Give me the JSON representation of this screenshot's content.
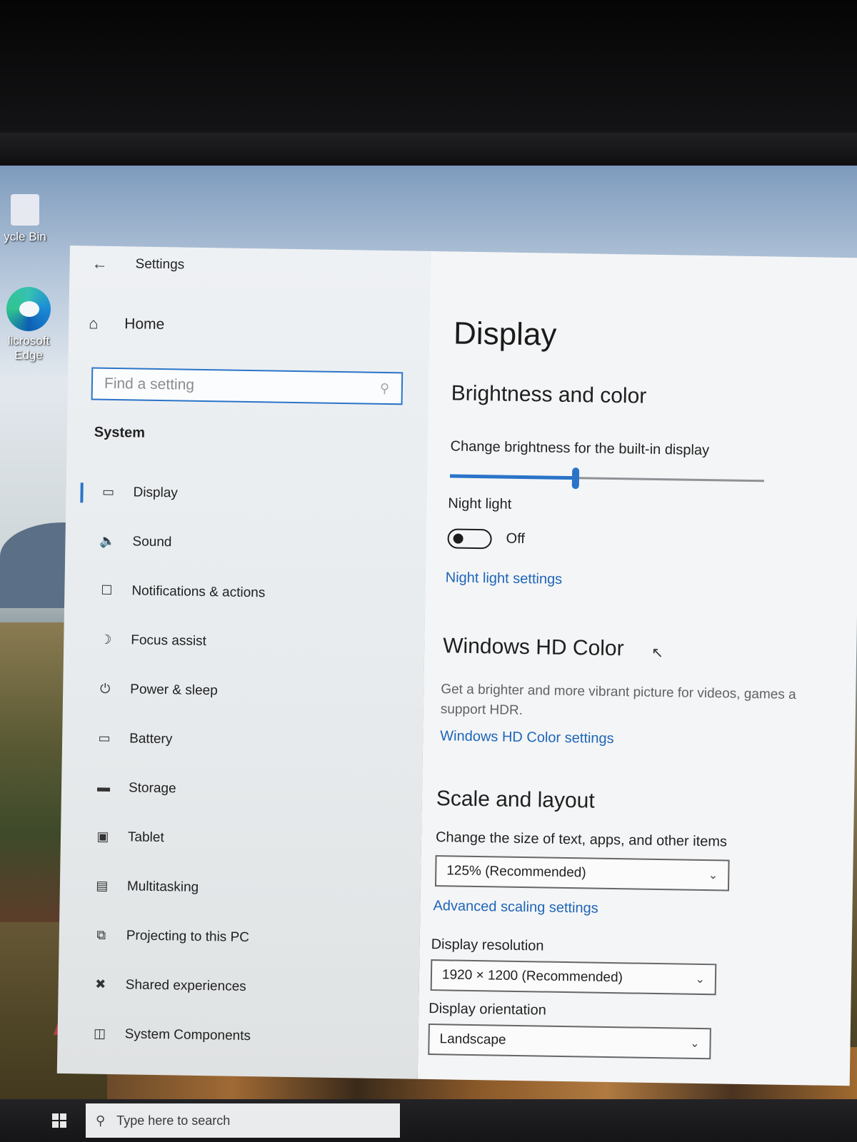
{
  "desktop": {
    "icons": [
      {
        "label": "ycle Bin"
      },
      {
        "label": "licrosoft Edge"
      }
    ]
  },
  "settings": {
    "title": "Settings",
    "home_label": "Home",
    "search_placeholder": "Find a setting",
    "section_header": "System",
    "nav_items": [
      {
        "label": "Display",
        "icon": "monitor-icon",
        "active": true
      },
      {
        "label": "Sound",
        "icon": "speaker-icon"
      },
      {
        "label": "Notifications & actions",
        "icon": "notification-icon"
      },
      {
        "label": "Focus assist",
        "icon": "moon-icon"
      },
      {
        "label": "Power & sleep",
        "icon": "power-icon"
      },
      {
        "label": "Battery",
        "icon": "battery-icon"
      },
      {
        "label": "Storage",
        "icon": "storage-icon"
      },
      {
        "label": "Tablet",
        "icon": "tablet-icon"
      },
      {
        "label": "Multitasking",
        "icon": "multitasking-icon"
      },
      {
        "label": "Projecting to this PC",
        "icon": "projecting-icon"
      },
      {
        "label": "Shared experiences",
        "icon": "shared-icon"
      },
      {
        "label": "System Components",
        "icon": "components-icon"
      }
    ]
  },
  "display": {
    "page_title": "Display",
    "brightness_heading": "Brightness and color",
    "brightness_label": "Change brightness for the built-in display",
    "brightness_level": 0.4,
    "night_light_label": "Night light",
    "night_light_state": "Off",
    "night_light_link": "Night light settings",
    "hd_heading": "Windows HD Color",
    "hd_desc": "Get a brighter and more vibrant picture for videos, games a support HDR.",
    "hd_link": "Windows HD Color settings",
    "scale_heading": "Scale and layout",
    "scale_label": "Change the size of text, apps, and other items",
    "scale_value": "125% (Recommended)",
    "advanced_link": "Advanced scaling settings",
    "resolution_label": "Display resolution",
    "resolution_value": "1920 × 1200 (Recommended)",
    "orientation_label": "Display orientation",
    "orientation_value": "Landscape"
  },
  "taskbar": {
    "search_placeholder": "Type here to search"
  },
  "colors": {
    "accent": "#2a74c8",
    "link": "#1d65b8"
  }
}
